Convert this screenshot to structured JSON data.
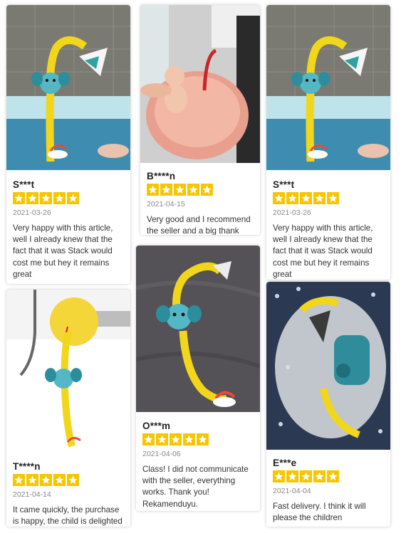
{
  "colors": {
    "star": "#f7c600",
    "name": "#222222",
    "date": "#888888",
    "text": "#333333"
  },
  "reviews": [
    {
      "author": "S***t",
      "rating": 5,
      "date": "2021-03-26",
      "text": "Very happy with this article, well I already knew that the fact that it was Stack would cost me but hey it remains great",
      "photo_icon": "elephant-shower-toy-photo"
    },
    {
      "author": "B****n",
      "rating": 5,
      "date": "2021-04-15",
      "text": "Very good and I recommend the seller and a big thank you",
      "photo_icon": "baby-bath-photo"
    },
    {
      "author": "S***t",
      "rating": 5,
      "date": "2021-03-26",
      "text": "Very happy with this article, well I already knew that the fact that it was Stack would cost me but hey it remains great",
      "photo_icon": "elephant-shower-toy-photo"
    },
    {
      "author": "T****n",
      "rating": 5,
      "date": "2021-04-14",
      "text": "It came quickly, the purchase is happy, the child is delighted",
      "photo_icon": "shower-on-bathtub-photo"
    },
    {
      "author": "O***m",
      "rating": 5,
      "date": "2021-04-06",
      "text": "Class! I did not communicate with the seller, everything works. Thank you! Rekamenduyu.",
      "photo_icon": "toy-on-fabric-photo"
    },
    {
      "author": "E***e",
      "rating": 5,
      "date": "2021-04-04",
      "text": "Fast delivery. I think it will please the children",
      "photo_icon": "packaged-toy-photo"
    }
  ]
}
